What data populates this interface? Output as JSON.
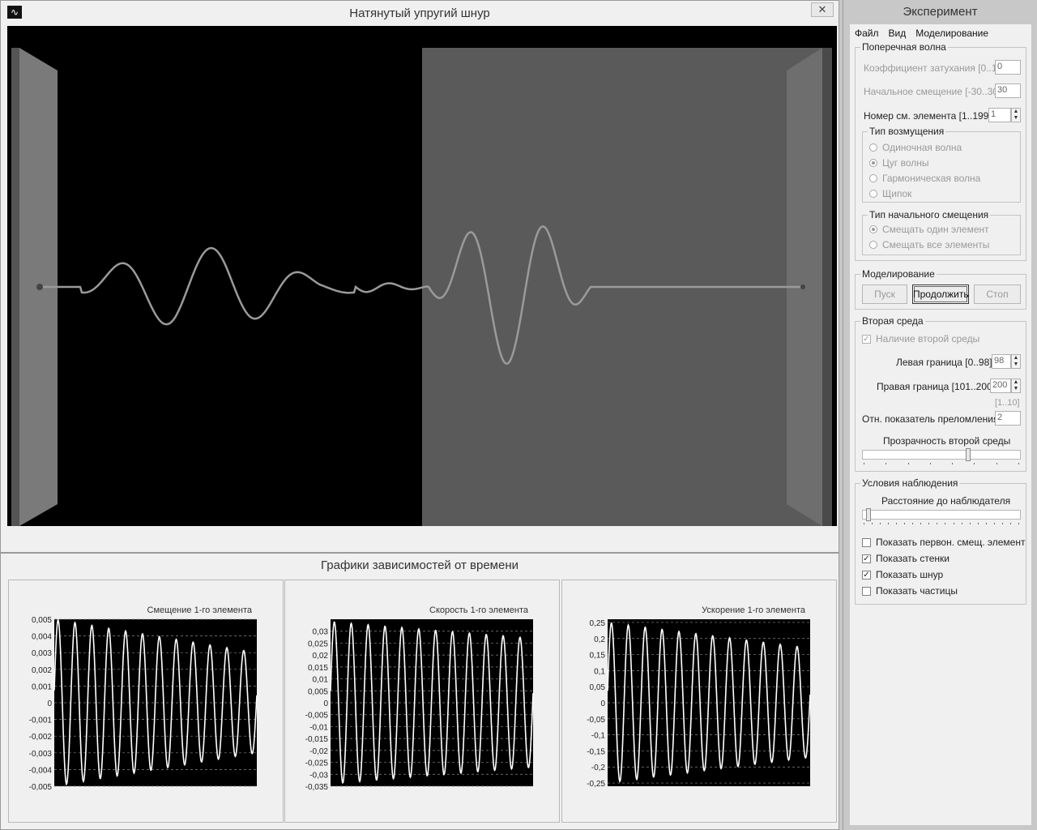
{
  "main_window": {
    "title": "Натянутый упругий шнур",
    "close_label": "✕",
    "icon_glyph": "∿"
  },
  "graphs": {
    "title": "Графики зависимостей от времени"
  },
  "chart_data": [
    {
      "type": "line",
      "title": "Смещение 1-го элемента",
      "yticks": [
        "0,005",
        "0,004",
        "0,003",
        "0,002",
        "0,001",
        "0",
        "-0,001",
        "-0,002",
        "-0,003",
        "-0,004",
        "-0,005"
      ],
      "ylim": [
        -0.005,
        0.005
      ],
      "amplitude_start": 0.005,
      "amplitude_end": 0.003,
      "cycles": 12,
      "grid": true
    },
    {
      "type": "line",
      "title": "Скорость 1-го элемента",
      "yticks": [
        "0,03",
        "0,025",
        "0,02",
        "0,015",
        "0,01",
        "0,005",
        "0",
        "-0,005",
        "-0,01",
        "-0,015",
        "-0,02",
        "-0,025",
        "-0,03",
        "-0,035"
      ],
      "ylim": [
        -0.035,
        0.035
      ],
      "amplitude_start": 0.034,
      "amplitude_end": 0.027,
      "cycles": 12,
      "grid": true
    },
    {
      "type": "line",
      "title": "Ускорение 1-го элемента",
      "yticks": [
        "0,25",
        "0,2",
        "0,15",
        "0,1",
        "0,05",
        "0",
        "-0,05",
        "-0,1",
        "-0,15",
        "-0,2",
        "-0,25"
      ],
      "ylim": [
        -0.26,
        0.26
      ],
      "amplitude_start": 0.25,
      "amplitude_end": 0.17,
      "cycles": 12,
      "grid": true
    }
  ],
  "side_panel": {
    "title": "Эксперимент",
    "menu": [
      "Файл",
      "Вид",
      "Моделирование"
    ],
    "transverse_wave": {
      "legend": "Поперечная волна",
      "damping_label": "Коэффициент затухания  [0..1]",
      "damping_value": "0",
      "initial_shift_label": "Начальное смещение  [-30..30]",
      "initial_shift_value": "30",
      "element_number_label": "Номер см. элемента  [1..199]",
      "element_number_value": "1",
      "disturbance_type": {
        "legend": "Тип возмущения",
        "options": [
          "Одиночная волна",
          "Цуг волны",
          "Гармоническая волна",
          "Щипок"
        ],
        "selected_index": 1
      },
      "initial_shift_type": {
        "legend": "Тип начального смещения",
        "options": [
          "Смещать один элемент",
          "Смещать все элементы"
        ],
        "selected_index": 0
      }
    },
    "modeling": {
      "legend": "Моделирование",
      "start_label": "Пуск",
      "continue_label": "Продолжить",
      "stop_label": "Стоп"
    },
    "second_medium": {
      "legend": "Вторая среда",
      "presence_label": "Наличие второй среды",
      "presence_checked": true,
      "left_bound_label": "Левая граница [0..98]",
      "left_bound_value": "98",
      "right_bound_label": "Правая граница [101..200]",
      "right_bound_value": "200",
      "refr_range_label": "[1..10]",
      "refr_label": "Отн. показатель преломления",
      "refr_value": "2",
      "transparency_label": "Прозрачность второй среды",
      "transparency_level": 0.67
    },
    "observation": {
      "legend": "Условия наблюдения",
      "distance_label": "Расстояние до наблюдателя",
      "distance_level": 0.02,
      "checks": [
        {
          "label": "Показать первон. смещ. элемент",
          "checked": false
        },
        {
          "label": "Показать стенки",
          "checked": true
        },
        {
          "label": "Показать шнур",
          "checked": true
        },
        {
          "label": "Показать частицы",
          "checked": false
        }
      ]
    }
  }
}
